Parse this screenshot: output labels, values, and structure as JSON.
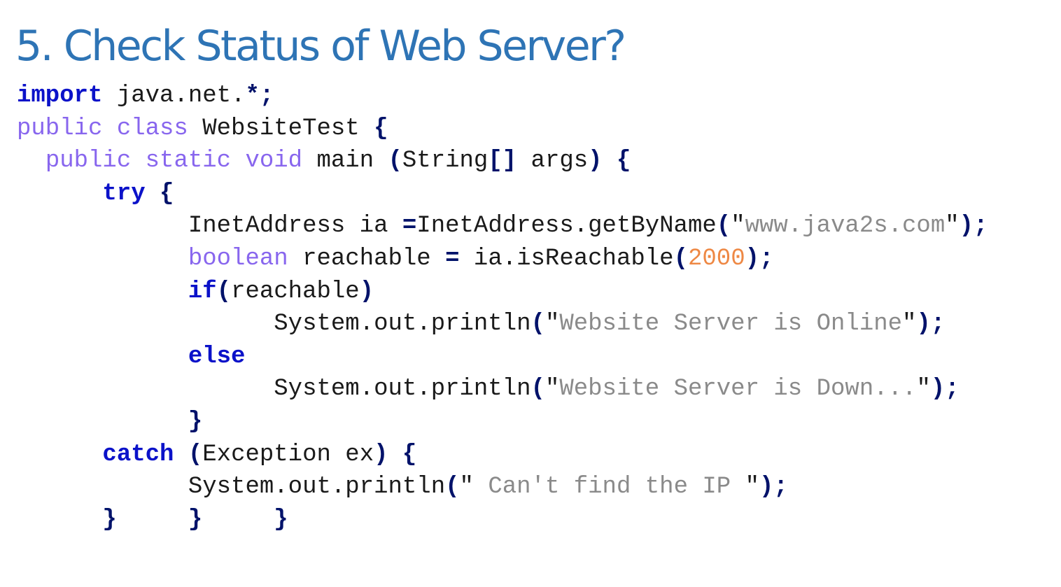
{
  "slide": {
    "title": "5. Check Status of Web Server?"
  },
  "code": {
    "lines": [
      [
        {
          "t": "import",
          "c": "kw"
        },
        {
          "t": " java.net."
        },
        {
          "t": "*;",
          "c": "op"
        }
      ],
      [
        {
          "t": "public class",
          "c": "mod"
        },
        {
          "t": " WebsiteTest "
        },
        {
          "t": "{",
          "c": "op"
        }
      ],
      [
        {
          "t": "  "
        },
        {
          "t": "public static void",
          "c": "mod"
        },
        {
          "t": " main "
        },
        {
          "t": "(",
          "c": "op"
        },
        {
          "t": "String"
        },
        {
          "t": "[]",
          "c": "op"
        },
        {
          "t": " args"
        },
        {
          "t": ")",
          "c": "op"
        },
        {
          "t": " "
        },
        {
          "t": "{",
          "c": "op"
        }
      ],
      [
        {
          "t": "      "
        },
        {
          "t": "try",
          "c": "kw"
        },
        {
          "t": " "
        },
        {
          "t": "{",
          "c": "op"
        }
      ],
      [
        {
          "t": "            InetAddress ia "
        },
        {
          "t": "=",
          "c": "op"
        },
        {
          "t": "InetAddress.getByName"
        },
        {
          "t": "(",
          "c": "op"
        },
        {
          "t": "\""
        },
        {
          "t": "www.java2s.com",
          "c": "str"
        },
        {
          "t": "\""
        },
        {
          "t": ");",
          "c": "op"
        }
      ],
      [
        {
          "t": "            "
        },
        {
          "t": "boolean",
          "c": "mod"
        },
        {
          "t": " reachable "
        },
        {
          "t": "=",
          "c": "op"
        },
        {
          "t": " ia.isReachable"
        },
        {
          "t": "(",
          "c": "op"
        },
        {
          "t": "2000",
          "c": "num"
        },
        {
          "t": ");",
          "c": "op"
        }
      ],
      [
        {
          "t": "            "
        },
        {
          "t": "if",
          "c": "kw"
        },
        {
          "t": "(",
          "c": "op"
        },
        {
          "t": "reachable"
        },
        {
          "t": ")",
          "c": "op"
        }
      ],
      [
        {
          "t": "                  System.out.println"
        },
        {
          "t": "(",
          "c": "op"
        },
        {
          "t": "\""
        },
        {
          "t": "Website Server is Online",
          "c": "str"
        },
        {
          "t": "\""
        },
        {
          "t": ");",
          "c": "op"
        }
      ],
      [
        {
          "t": "            "
        },
        {
          "t": "else",
          "c": "kw"
        }
      ],
      [
        {
          "t": "                  System.out.println"
        },
        {
          "t": "(",
          "c": "op"
        },
        {
          "t": "\""
        },
        {
          "t": "Website Server is Down...",
          "c": "str"
        },
        {
          "t": "\""
        },
        {
          "t": ");",
          "c": "op"
        }
      ],
      [
        {
          "t": "            "
        },
        {
          "t": "}",
          "c": "op"
        }
      ],
      [
        {
          "t": "      "
        },
        {
          "t": "catch",
          "c": "kw"
        },
        {
          "t": " "
        },
        {
          "t": "(",
          "c": "op"
        },
        {
          "t": "Exception ex"
        },
        {
          "t": ")",
          "c": "op"
        },
        {
          "t": " "
        },
        {
          "t": "{",
          "c": "op"
        }
      ],
      [
        {
          "t": "            System.out.println"
        },
        {
          "t": "(",
          "c": "op"
        },
        {
          "t": "\""
        },
        {
          "t": " Can't find the IP ",
          "c": "str"
        },
        {
          "t": "\""
        },
        {
          "t": ");",
          "c": "op"
        }
      ],
      [
        {
          "t": "      "
        },
        {
          "t": "}",
          "c": "op"
        },
        {
          "t": "     "
        },
        {
          "t": "}",
          "c": "op"
        },
        {
          "t": "     "
        },
        {
          "t": "}",
          "c": "op"
        }
      ]
    ]
  }
}
